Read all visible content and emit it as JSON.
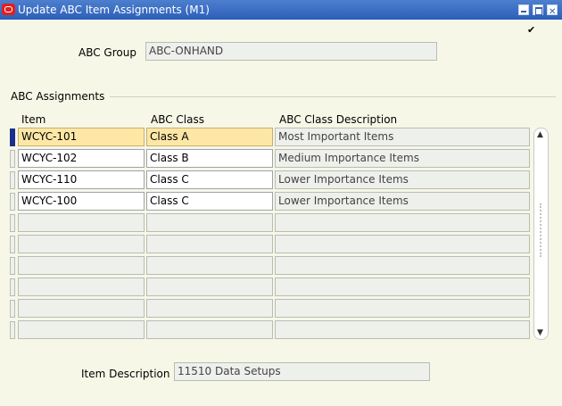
{
  "window": {
    "title": "Update ABC Item Assignments (M1)",
    "checkbox_mark": "✔"
  },
  "abc_group": {
    "label": "ABC Group",
    "value": "ABC-ONHAND"
  },
  "assignments": {
    "section_title": "ABC Assignments",
    "columns": {
      "item": "Item",
      "abc_class": "ABC Class",
      "description": "ABC Class Description"
    },
    "rows": [
      {
        "item": "WCYC-101",
        "abc_class": "Class A",
        "description": "Most Important Items"
      },
      {
        "item": "WCYC-102",
        "abc_class": "Class B",
        "description": "Medium Importance Items"
      },
      {
        "item": "WCYC-110",
        "abc_class": "Class C",
        "description": "Lower Importance Items"
      },
      {
        "item": "WCYC-100",
        "abc_class": "Class C",
        "description": "Lower Importance Items"
      },
      {
        "item": "",
        "abc_class": "",
        "description": ""
      },
      {
        "item": "",
        "abc_class": "",
        "description": ""
      },
      {
        "item": "",
        "abc_class": "",
        "description": ""
      },
      {
        "item": "",
        "abc_class": "",
        "description": ""
      },
      {
        "item": "",
        "abc_class": "",
        "description": ""
      },
      {
        "item": "",
        "abc_class": "",
        "description": ""
      }
    ]
  },
  "item_description": {
    "label": "Item Description",
    "value": "11510 Data Setups"
  },
  "scrollbar": {
    "up_arrow": "▲",
    "down_arrow": "▼"
  }
}
